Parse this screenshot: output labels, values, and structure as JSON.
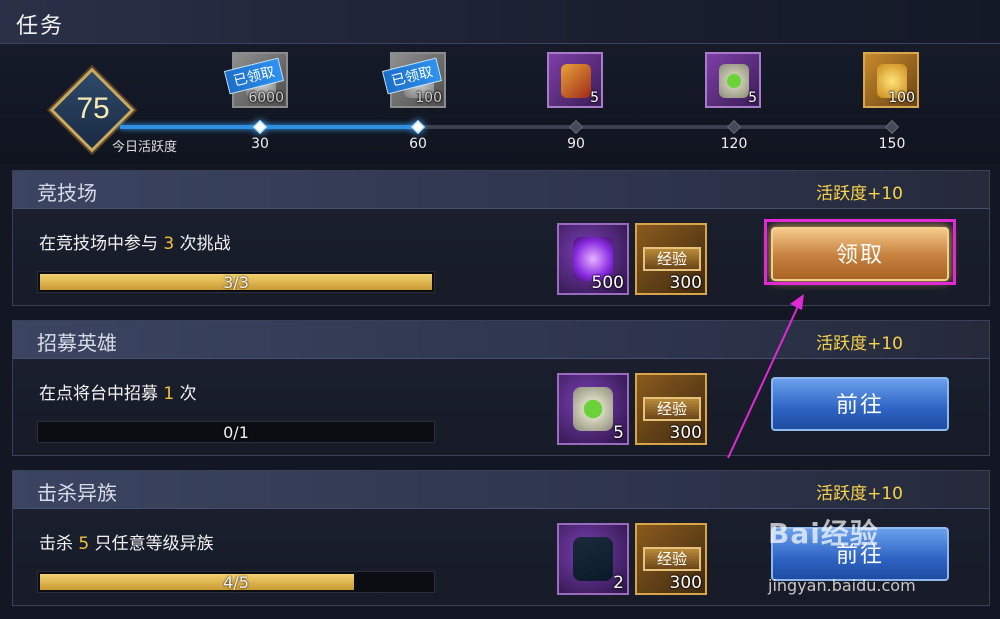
{
  "window": {
    "title": "任务"
  },
  "activity": {
    "level": "75",
    "label": "今日活跃度",
    "progress_fraction": 0.5,
    "milestones": [
      {
        "value": "30",
        "reward_count": "6000",
        "claimed": true,
        "claimed_label": "已领取",
        "color": "#8f8f8f",
        "icon": "coin-stack-icon"
      },
      {
        "value": "60",
        "reward_count": "100",
        "claimed": true,
        "claimed_label": "已领取",
        "color": "#8f8f8f",
        "icon": "gem-icon"
      },
      {
        "value": "90",
        "reward_count": "5",
        "claimed": false,
        "color": "#7d3fa8",
        "icon": "scroll-icon"
      },
      {
        "value": "120",
        "reward_count": "5",
        "claimed": false,
        "color": "#7d3fa8",
        "icon": "jade-talisman-icon"
      },
      {
        "value": "150",
        "reward_count": "100",
        "claimed": false,
        "color": "#c88a2a",
        "icon": "gold-ingot-icon"
      }
    ]
  },
  "tasks": [
    {
      "title": "竞技场",
      "bonus": "活跃度+10",
      "desc_prefix": "在竞技场中参与 ",
      "desc_num": "3",
      "desc_suffix": " 次挑战",
      "progress_text": "3/3",
      "progress_fraction": 1.0,
      "rewards": [
        {
          "icon": "purple-orb-icon",
          "count": "500"
        },
        {
          "icon": "exp-icon",
          "label": "经验",
          "count": "300"
        }
      ],
      "button": "领取",
      "button_type": "claim"
    },
    {
      "title": "招募英雄",
      "bonus": "活跃度+10",
      "desc_prefix": "在点将台中招募 ",
      "desc_num": "1",
      "desc_suffix": " 次",
      "progress_text": "0/1",
      "progress_fraction": 0.0,
      "rewards": [
        {
          "icon": "jade-talisman-icon",
          "count": "5"
        },
        {
          "icon": "exp-icon",
          "label": "经验",
          "count": "300"
        }
      ],
      "button": "前往",
      "button_type": "go"
    },
    {
      "title": "击杀异族",
      "bonus": "活跃度+10",
      "desc_prefix": "击杀 ",
      "desc_num": "5",
      "desc_suffix": " 只任意等级异族",
      "progress_text": "4/5",
      "progress_fraction": 0.8,
      "rewards": [
        {
          "icon": "boot-icon",
          "count": "2"
        },
        {
          "icon": "exp-icon",
          "label": "经验",
          "count": "300"
        }
      ],
      "button": "前往",
      "button_type": "go"
    }
  ],
  "watermark": {
    "brand": "Bai经验",
    "url": "jingyan.baidu.com"
  },
  "colors": {
    "accent_gold": "#f7d34a",
    "highlight": "#e12ad6",
    "progress_blue": "#2f8fe0"
  }
}
